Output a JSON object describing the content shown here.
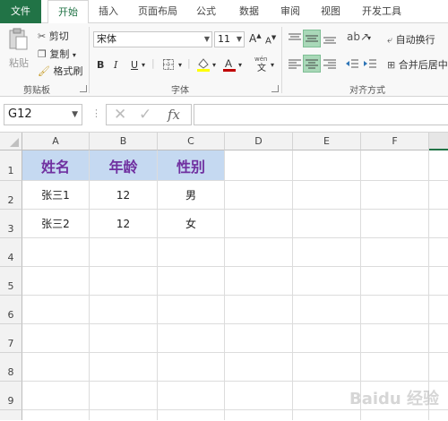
{
  "tabs": [
    "文件",
    "开始",
    "插入",
    "页面布局",
    "公式",
    "数据",
    "审阅",
    "视图",
    "开发工具"
  ],
  "clipboard": {
    "paste": "粘贴",
    "cut": "剪切",
    "copy": "复制",
    "format_painter": "格式刷",
    "group": "剪贴板"
  },
  "font": {
    "name": "宋体",
    "size": "11",
    "bold": "B",
    "italic": "I",
    "underline": "U",
    "group": "字体"
  },
  "alignment": {
    "wrap": "自动换行",
    "merge": "合并后居中",
    "group": "对齐方式"
  },
  "formula_bar": {
    "name_box": "G12",
    "fx": "fx",
    "content": ""
  },
  "columns": [
    "A",
    "B",
    "C",
    "D",
    "E",
    "F"
  ],
  "rows": [
    "1",
    "2",
    "3",
    "4",
    "5",
    "6",
    "7",
    "8",
    "9"
  ],
  "table": {
    "headers": [
      "姓名",
      "年龄",
      "性别"
    ],
    "rows": [
      [
        "张三1",
        "12",
        "男"
      ],
      [
        "张三2",
        "12",
        "女"
      ]
    ]
  },
  "colors": {
    "accent": "#217346",
    "header_fill": "#c5d9f1",
    "header_text": "#7030a0"
  },
  "watermark": "Baidu 经验"
}
